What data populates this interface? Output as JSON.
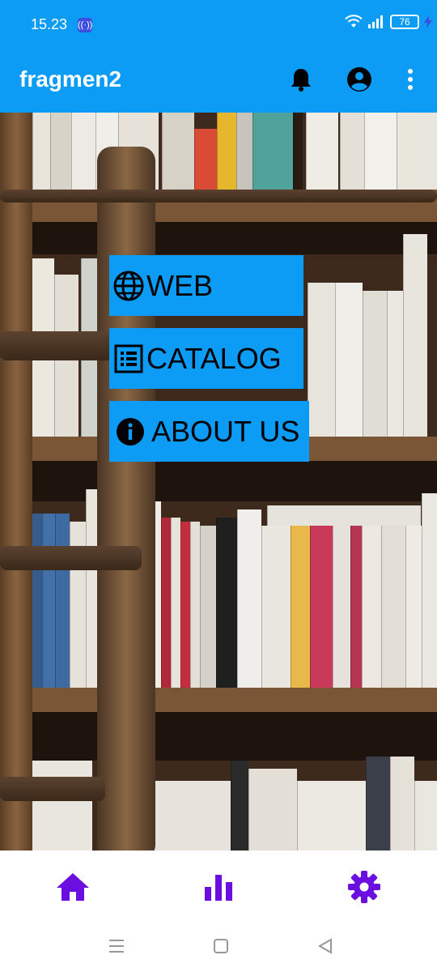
{
  "status": {
    "time": "15.23",
    "battery": "76",
    "icons": [
      "hotspot-icon",
      "wifi-icon",
      "signal-icon",
      "battery-icon",
      "charging-icon"
    ]
  },
  "appbar": {
    "title": "fragmen2",
    "actions": [
      "bell-icon",
      "account-icon",
      "more-vert-icon"
    ]
  },
  "menu": {
    "items": [
      {
        "label": "WEB",
        "icon": "globe-icon"
      },
      {
        "label": "CATALOG",
        "icon": "list-icon"
      },
      {
        "label": "ABOUT US",
        "icon": "info-icon"
      }
    ]
  },
  "bottom_nav": {
    "items": [
      "home-icon",
      "bar-chart-icon",
      "settings-icon"
    ],
    "accent": "#6a0fe0"
  },
  "system_nav": [
    "menu-icon",
    "home-square-icon",
    "back-triangle-icon"
  ],
  "colors": {
    "primary": "#0d9cf5",
    "accent": "#6a0fe0"
  }
}
